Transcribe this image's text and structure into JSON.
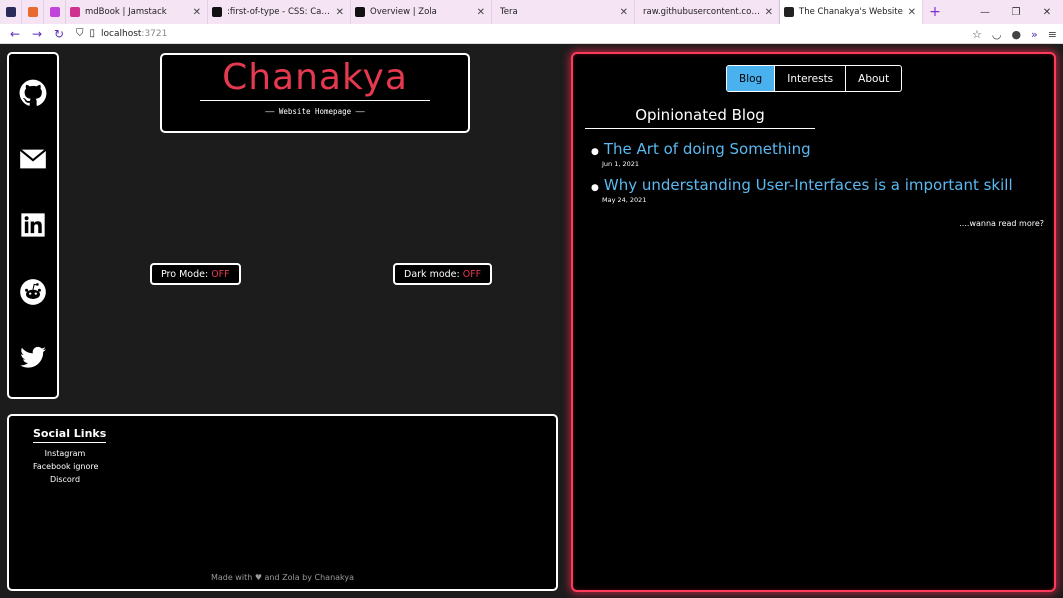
{
  "browser": {
    "tabs": [
      {
        "title": "",
        "fav_color": "#2b2b5a",
        "pinned": true
      },
      {
        "title": "",
        "fav_color": "#e86a2c",
        "pinned": true
      },
      {
        "title": "",
        "fav_color": "#c044d9",
        "pinned": true
      },
      {
        "title": "mdBook | Jamstack",
        "fav_color": "#d0338f",
        "pinned": false
      },
      {
        "title": ":first-of-type - CSS: Cascading",
        "fav_color": "#111111",
        "pinned": false
      },
      {
        "title": "Overview | Zola",
        "fav_color": "#111111",
        "pinned": false
      },
      {
        "title": "Tera",
        "fav_color": "",
        "pinned": false
      },
      {
        "title": "raw.githubusercontent.com/FortA",
        "fav_color": "",
        "pinned": false
      },
      {
        "title": "The Chanakya's Website",
        "fav_color": "#222222",
        "pinned": false,
        "active": true
      }
    ],
    "close_glyph": "✕",
    "new_tab": "+",
    "url_host": "localhost",
    "url_port": ":3721",
    "win_min": "—",
    "win_max": "❐",
    "win_close": "✕"
  },
  "site": {
    "title": "Chanakya",
    "subtitle": "——  Website Homepage  ——",
    "pro_mode_label": "Pro Mode:",
    "pro_mode_state": "OFF",
    "dark_mode_label": "Dark mode:",
    "dark_mode_state": "OFF",
    "social_icons": [
      "github-icon",
      "email-icon",
      "linkedin-icon",
      "reddit-icon",
      "twitter-icon"
    ],
    "footer": {
      "links_title": "Social Links",
      "links": [
        "Instagram",
        "Facebook ignore",
        "Discord"
      ],
      "made_with": "Made with ♥ and Zola by Chanakya"
    }
  },
  "blog": {
    "tabs": [
      "Blog",
      "Interests",
      "About"
    ],
    "active_tab": "Blog",
    "heading": "Opinionated Blog",
    "posts": [
      {
        "title": "The Art of doing Something",
        "date": "Jun 1, 2021"
      },
      {
        "title": "Why understanding User-Interfaces is a important skill",
        "date": "May 24, 2021"
      }
    ],
    "read_more": "....wanna read more?"
  },
  "colors": {
    "accent_red": "#e53950",
    "link_blue": "#5bb8f0",
    "active_tab_blue": "#4ab1ef",
    "neon_border": "#ff3b5c"
  }
}
